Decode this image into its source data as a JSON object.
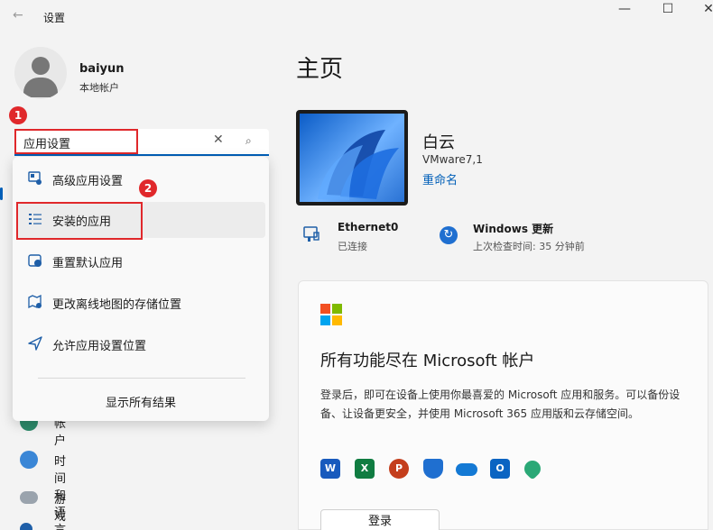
{
  "titlebar": {
    "back_glyph": "←",
    "title": "设置",
    "min_glyph": "—",
    "max_glyph": "☐",
    "close_glyph": "✕"
  },
  "user": {
    "name": "baiyun",
    "account_type": "本地帐户"
  },
  "search": {
    "value": "应用设置",
    "clear_glyph": "✕",
    "search_glyph": "⌕"
  },
  "annotations": {
    "step1": "1",
    "step2": "2"
  },
  "dropdown": {
    "items": [
      {
        "label": "高级应用设置",
        "icon": "advanced-apps-icon"
      },
      {
        "label": "安装的应用",
        "icon": "installed-apps-icon"
      },
      {
        "label": "重置默认应用",
        "icon": "default-apps-icon"
      },
      {
        "label": "更改离线地图的存储位置",
        "icon": "offline-maps-icon"
      },
      {
        "label": "允许应用设置位置",
        "icon": "location-icon"
      }
    ],
    "show_all": "显示所有结果"
  },
  "sidebar": {
    "items": [
      {
        "label": "帐户",
        "icon": "accounts-icon"
      },
      {
        "label": "时间和语言",
        "icon": "time-language-icon"
      },
      {
        "label": "游戏",
        "icon": "gaming-icon"
      }
    ]
  },
  "main": {
    "title": "主页",
    "device": {
      "name": "白云",
      "model": "VMware7,1",
      "rename": "重命名"
    },
    "network": {
      "title": "Ethernet0",
      "status": "已连接"
    },
    "update": {
      "title": "Windows 更新",
      "status": "上次检查时间: 35 分钟前"
    },
    "ms_card": {
      "title": "所有功能尽在 Microsoft 帐户",
      "description": "登录后，即可在设备上使用你最喜爱的 Microsoft 应用和服务。可以备份设备、让设备更安全，并使用 Microsoft 365 应用版和云存储空间。",
      "signin": "登录",
      "apps": [
        "word-icon",
        "excel-icon",
        "powerpoint-icon",
        "defender-icon",
        "onedrive-icon",
        "outlook-icon",
        "family-icon"
      ]
    }
  },
  "colors": {
    "accent": "#005fb8",
    "annotation_red": "#e0282b"
  }
}
